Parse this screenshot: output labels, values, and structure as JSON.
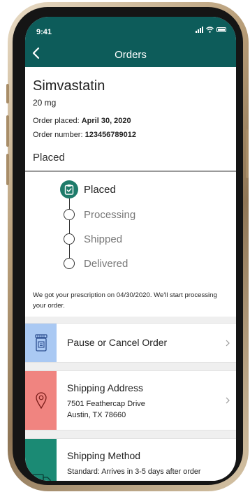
{
  "status_bar": {
    "time": "9:41"
  },
  "header": {
    "title": "Orders"
  },
  "order": {
    "drug_name": "Simvastatin",
    "dose": "20 mg",
    "placed_label": "Order placed:",
    "placed_value": "April 30, 2020",
    "number_label": "Order number:",
    "number_value": "123456789012",
    "status": "Placed"
  },
  "tracker": {
    "steps": [
      {
        "label": "Placed",
        "active": true
      },
      {
        "label": "Processing",
        "active": false
      },
      {
        "label": "Shipped",
        "active": false
      },
      {
        "label": "Delivered",
        "active": false
      }
    ]
  },
  "note": "We got your prescription on 04/30/2020. We'll start processing your order.",
  "actions": {
    "pause": {
      "title": "Pause or Cancel Order",
      "color": "#aac9f3",
      "icon": "pill-bottle-icon"
    },
    "address": {
      "title": "Shipping Address",
      "line1": "7501 Feathercap Drive",
      "line2": "Austin, TX 78660",
      "color": "#f08480",
      "icon": "location-pin-icon"
    },
    "method": {
      "title": "Shipping Method",
      "line1": "Standard: Arrives in 3-5 days after order",
      "color": "#1b8a74",
      "icon": "truck-icon"
    }
  },
  "colors": {
    "header": "#0d5c5a",
    "active_step": "#1e7b6a"
  }
}
